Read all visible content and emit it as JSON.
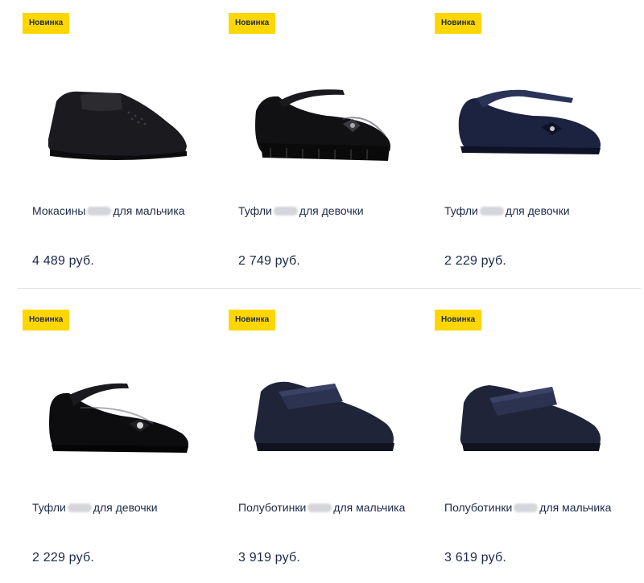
{
  "badge_label": "Новинка",
  "products": [
    {
      "title_before": "Мокасины",
      "title_after": "для мальчика",
      "price": "4 489 руб.",
      "image": "loafer-black"
    },
    {
      "title_before": "Туфли",
      "title_after": "для девочки",
      "price": "2 749 руб.",
      "image": "mary-jane-patent-bow"
    },
    {
      "title_before": "Туфли",
      "title_after": "для девочки",
      "price": "2 229 руб.",
      "image": "mary-jane-navy"
    },
    {
      "title_before": "Туфли",
      "title_after": "для девочки",
      "price": "2 229 руб.",
      "image": "mary-jane-patent-flower"
    },
    {
      "title_before": "Полуботинки",
      "title_after": "для мальчика",
      "price": "3 919 руб.",
      "image": "velcro-shoe-navy"
    },
    {
      "title_before": "Полуботинки",
      "title_after": "для мальчика",
      "price": "3 619 руб.",
      "image": "velcro-shoe-navy-2"
    }
  ],
  "colors": {
    "badge": "#ffd600",
    "text": "#1b2a4a",
    "divider": "#dcdde2"
  }
}
